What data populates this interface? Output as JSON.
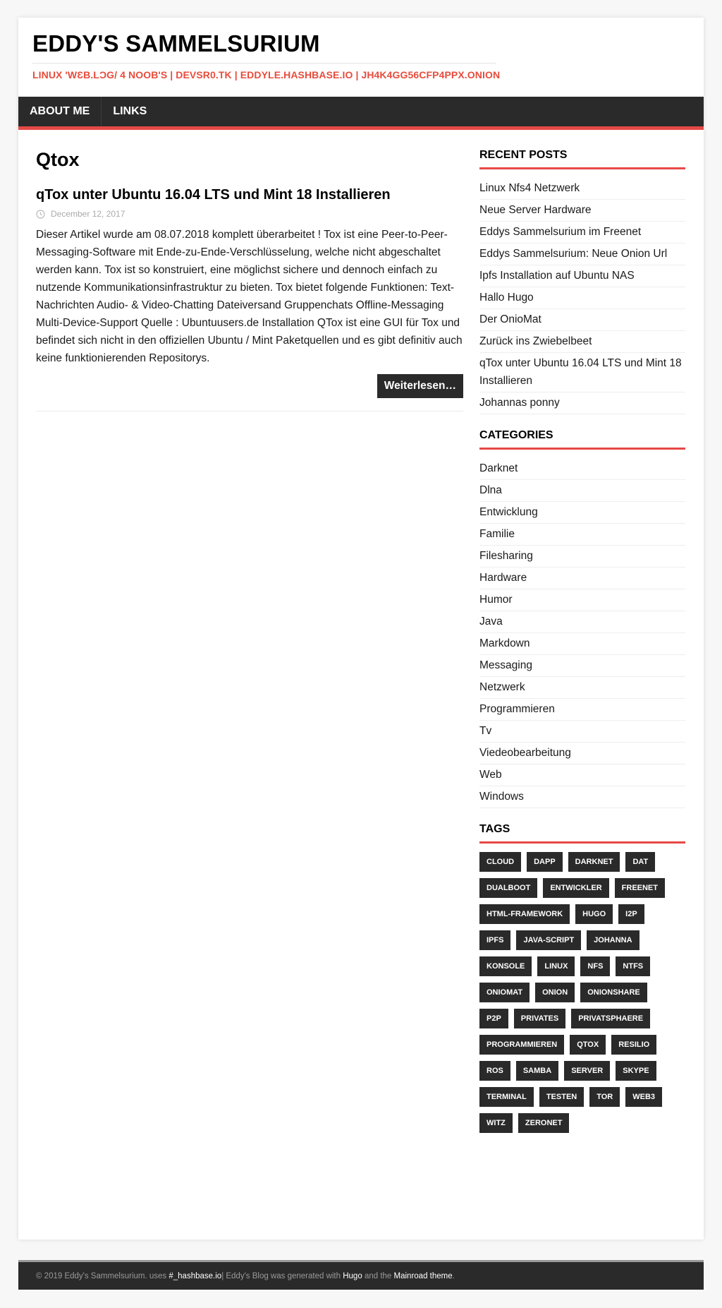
{
  "header": {
    "site_title": "EDDY'S SAMMELSURIUM",
    "site_description": "LINUX 'WƐB.LϽG/ 4 NOOB'S | DEVSR0.TK | EDDYLE.HASHBASE.IO | JH4K4GG56CFP4PPX.ONION"
  },
  "nav": {
    "items": [
      {
        "label": "ABOUT ME"
      },
      {
        "label": "LINKS"
      }
    ]
  },
  "main": {
    "page_title": "Qtox",
    "posts": [
      {
        "title": "qTox unter Ubuntu 16.04 LTS und Mint 18 Installieren",
        "date": "December 12, 2017",
        "excerpt": "Dieser Artikel wurde am 08.07.2018 komplett überarbeitet ! Tox ist eine Peer-to-Peer-Messaging-Software mit Ende-zu-Ende-Verschlüsselung, welche nicht abgeschaltet werden kann. Tox ist so konstruiert, eine möglichst sichere und dennoch einfach zu nutzende Kommunikationsinfrastruktur zu bieten. Tox bietet folgende Funktionen: Text-Nachrichten Audio- & Video-Chatting Dateiversand Gruppenchats Offline-Messaging Multi-Device-Support Quelle : Ubuntuusers.de Installation QTox ist eine GUI für Tox und befindet sich nicht in den offiziellen Ubuntu / Mint Paketquellen und es gibt definitiv auch keine funktionierenden Repositorys.",
        "read_more": "Weiterlesen…"
      }
    ]
  },
  "sidebar": {
    "recent_posts": {
      "title": "RECENT POSTS",
      "items": [
        "Linux Nfs4 Netzwerk",
        "Neue Server Hardware",
        "Eddys Sammelsurium im Freenet",
        "Eddys Sammelsurium: Neue Onion Url",
        "Ipfs Installation auf Ubuntu NAS",
        "Hallo Hugo",
        "Der OnioMat",
        "Zurück ins Zwiebelbeet",
        "qTox unter Ubuntu 16.04 LTS und Mint 18 Installieren",
        "Johannas ponny"
      ]
    },
    "categories": {
      "title": "CATEGORIES",
      "items": [
        "Darknet",
        "Dlna",
        "Entwicklung",
        "Familie",
        "Filesharing",
        "Hardware",
        "Humor",
        "Java",
        "Markdown",
        "Messaging",
        "Netzwerk",
        "Programmieren",
        "Tv",
        "Viedeobearbeitung",
        "Web",
        "Windows"
      ]
    },
    "tags": {
      "title": "TAGS",
      "items": [
        "CLOUD",
        "DAPP",
        "DARKNET",
        "DAT",
        "DUALBOOT",
        "ENTWICKLER",
        "FREENET",
        "HTML-FRAMEWORK",
        "HUGO",
        "I2P",
        "IPFS",
        "JAVA-SCRIPT",
        "JOHANNA",
        "KONSOLE",
        "LINUX",
        "NFS",
        "NTFS",
        "ONIOMAT",
        "ONION",
        "ONIONSHARE",
        "P2P",
        "PRIVATES",
        "PRIVATSPHAERE",
        "PROGRAMMIEREN",
        "QTOX",
        "RESILIO",
        "ROS",
        "SAMBA",
        "SERVER",
        "SKYPE",
        "TERMINAL",
        "TESTEN",
        "TOR",
        "WEB3",
        "WITZ",
        "ZERONET"
      ]
    }
  },
  "footer": {
    "copyright": "© 2019 Eddy's Sammelsurium. uses ",
    "hashbase_link": "#_hashbase.io",
    "middle": " | Eddy's Blog was generated with ",
    "hugo_link": "Hugo",
    "and_the": " and the ",
    "theme_link": "Mainroad theme",
    "end": "."
  },
  "colors": {
    "accent": "#e64946",
    "dark": "#2a2a2a",
    "description": "#e74c3c"
  }
}
